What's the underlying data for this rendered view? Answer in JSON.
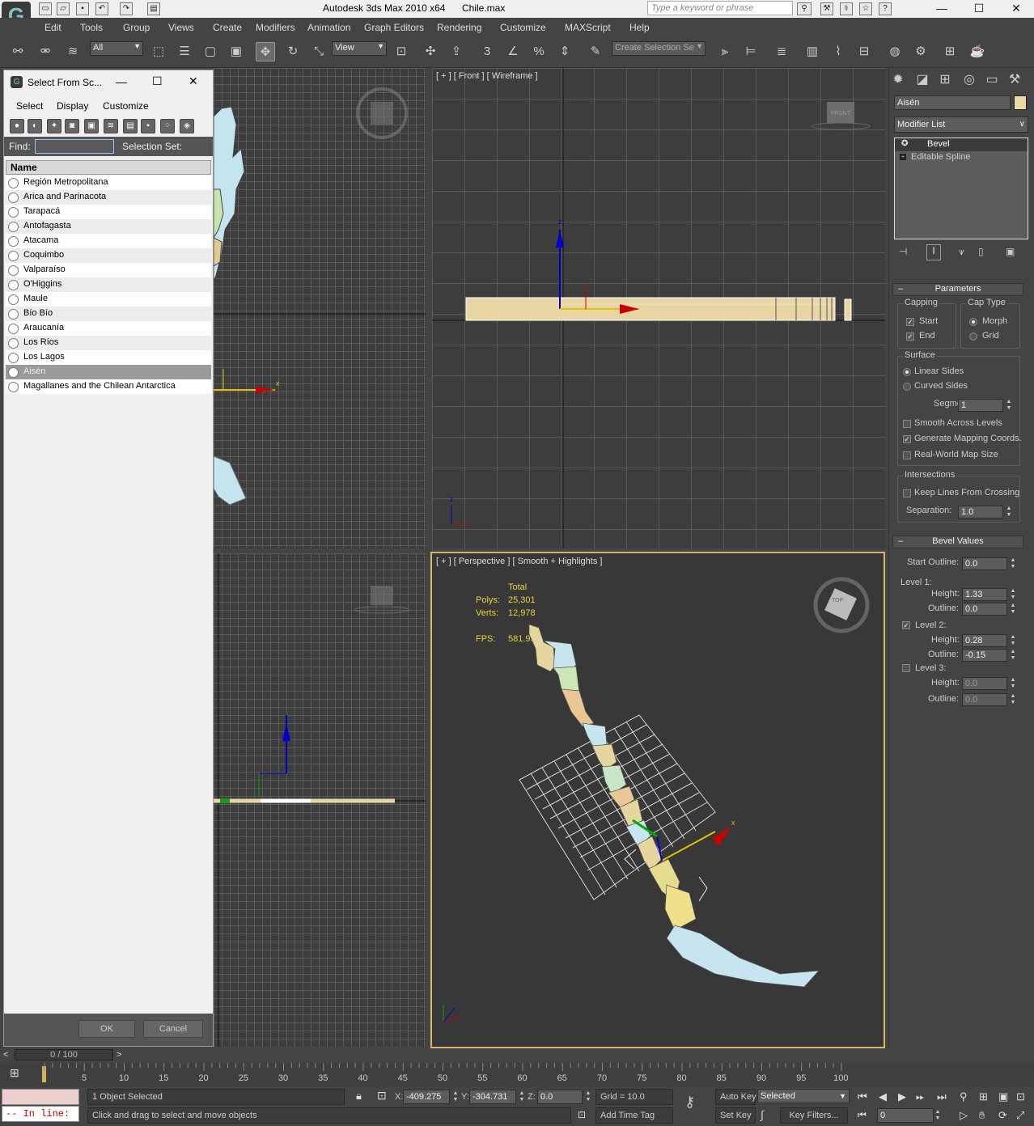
{
  "titlebar": {
    "app_title": "Autodesk 3ds Max  2010 x64",
    "file_name": "Chile.max",
    "search_placeholder": "Type a keyword or phrase",
    "minimize": "—",
    "maximize": "☐",
    "close": "✕"
  },
  "menu": [
    "Edit",
    "Tools",
    "Group",
    "Views",
    "Create",
    "Modifiers",
    "Animation",
    "Graph Editors",
    "Rendering",
    "Customize",
    "MAXScript",
    "Help"
  ],
  "toolbar": {
    "filter_value": "All",
    "refcoord_value": "View",
    "selection_set_placeholder": "Create Selection Se",
    "snap_label": "3",
    "angle_snap_label": "%"
  },
  "dialog": {
    "title": "Select From Sc...",
    "menu": [
      "Select",
      "Display",
      "Customize"
    ],
    "find_label": "Find:",
    "selection_set_label": "Selection Set:",
    "column_header": "Name",
    "objects": [
      "Región Metropolitana",
      "Arica and Parinacota",
      "Tarapacá",
      "Antofagasta",
      "Atacama",
      "Coquimbo",
      "Valparaíso",
      "O'Higgins",
      "Maule",
      "Bío Bío",
      "Araucanía",
      "Los Ríos",
      "Los Lagos",
      "Aisén",
      "Magallanes and the Chilean Antarctica"
    ],
    "selected": "Aisén",
    "ok": "OK",
    "cancel": "Cancel"
  },
  "viewports": {
    "front_label": "[ + ] [ Front ] [ Wireframe ]",
    "persp_label": "[ + ] [ Perspective ] [ Smooth + Highlights ]",
    "front_cube": "FRONT",
    "top_cube": "TOP",
    "stats": {
      "total": "Total",
      "polys_label": "Polys:",
      "polys": "25,301",
      "verts_label": "Verts:",
      "verts": "12,978",
      "fps_label": "FPS:",
      "fps": "581.959"
    }
  },
  "command_panel": {
    "object_name": "Aisén",
    "object_color": "#e8d9a8",
    "modifier_list": "Modifier List",
    "stack": [
      "Bevel",
      "Editable Spline"
    ],
    "parameters": {
      "header": "Parameters",
      "capping": "Capping",
      "start": "Start",
      "end": "End",
      "cap_type": "Cap Type",
      "morph": "Morph",
      "grid": "Grid",
      "surface": "Surface",
      "linear_sides": "Linear Sides",
      "curved_sides": "Curved Sides",
      "segments_label": "Segments:",
      "segments": "1",
      "smooth_across": "Smooth Across Levels",
      "gen_mapping": "Generate Mapping Coords.",
      "real_world": "Real-World Map Size",
      "intersections": "Intersections",
      "keep_lines": "Keep Lines From Crossing",
      "separation_label": "Separation:",
      "separation": "1.0"
    },
    "bevel_values": {
      "header": "Bevel Values",
      "start_outline_label": "Start Outline:",
      "start_outline": "0.0",
      "level1": "Level 1:",
      "l1_height": "1.33",
      "l1_outline": "0.0",
      "level2": "Level 2:",
      "l2_height": "0.28",
      "l2_outline": "-0.15",
      "level3": "Level 3:",
      "l3_height": "0.0",
      "l3_outline": "0.0",
      "height_label": "Height:",
      "outline_label": "Outline:"
    }
  },
  "timeline": {
    "frame_display": "0 / 100",
    "ticks": [
      "5",
      "10",
      "15",
      "20",
      "25",
      "30",
      "35",
      "40",
      "45",
      "50",
      "55",
      "60",
      "65",
      "70",
      "75",
      "80",
      "85",
      "90",
      "95",
      "100"
    ]
  },
  "status": {
    "script_line": "-- In line:",
    "selected_count": "1 Object Selected",
    "prompt": "Click and drag to select and move objects",
    "x_label": "X:",
    "x": "-409.275",
    "y_label": "Y:",
    "y": "-304.731",
    "z_label": "Z:",
    "z": "0.0",
    "grid": "Grid = 10.0",
    "add_time_tag": "Add Time Tag",
    "auto_key": "Auto Key",
    "set_key": "Set Key",
    "key_mode": "Selected",
    "key_filters": "Key Filters...",
    "frame": "0"
  }
}
